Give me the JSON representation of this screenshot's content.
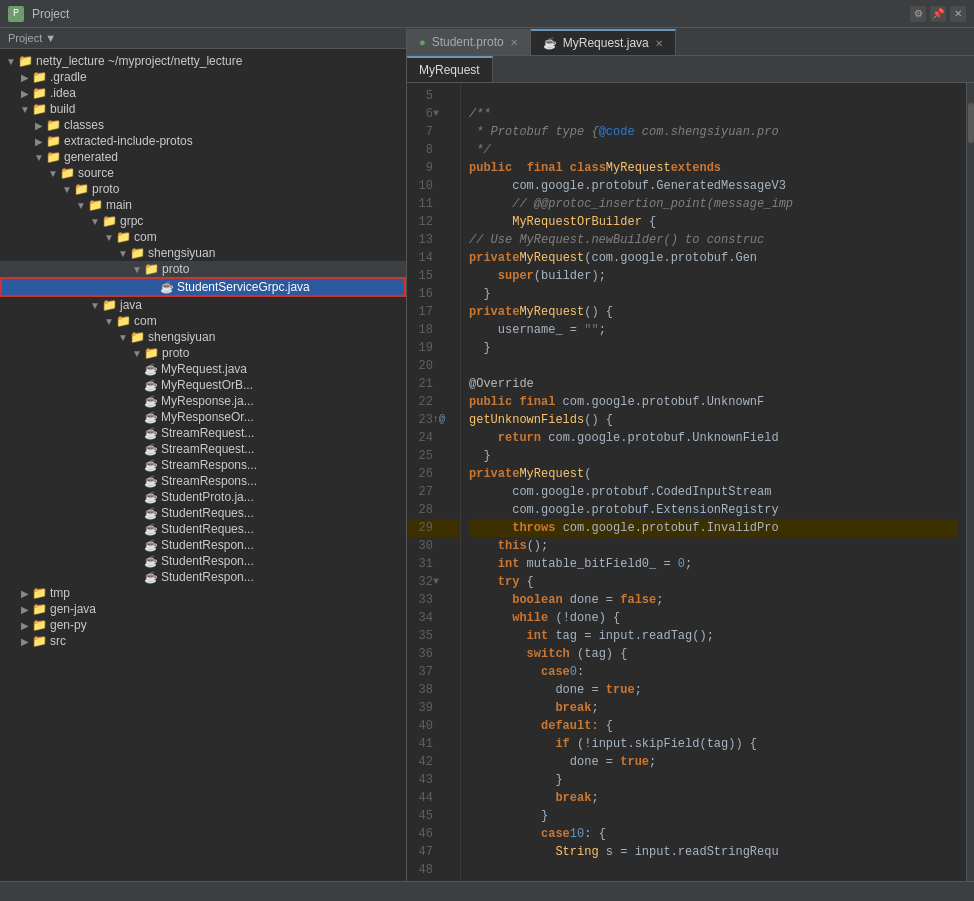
{
  "titleBar": {
    "title": "Project",
    "projectPath": "~/myproject/netty_lecture"
  },
  "tabs": [
    {
      "id": "student-proto",
      "label": "Student.proto",
      "icon": "proto",
      "active": false
    },
    {
      "id": "myrequest-java",
      "label": "MyRequest.java",
      "icon": "java",
      "active": true
    }
  ],
  "editorTabs": [
    {
      "id": "myrequest",
      "label": "MyRequest",
      "active": true
    }
  ],
  "fileTree": {
    "root": "netty_lecture",
    "items": [
      {
        "id": "netty-lecture",
        "label": "netty_lecture ~/myproject/netty_lecture",
        "level": 0,
        "type": "folder",
        "expanded": true
      },
      {
        "id": "gradle",
        "label": ".gradle",
        "level": 1,
        "type": "folder",
        "expanded": false
      },
      {
        "id": "idea",
        "label": ".idea",
        "level": 1,
        "type": "folder",
        "expanded": false
      },
      {
        "id": "build",
        "label": "build",
        "level": 1,
        "type": "folder",
        "expanded": true
      },
      {
        "id": "classes",
        "label": "classes",
        "level": 2,
        "type": "folder",
        "expanded": false
      },
      {
        "id": "extracted-include-protos",
        "label": "extracted-include-protos",
        "level": 2,
        "type": "folder",
        "expanded": false
      },
      {
        "id": "generated",
        "label": "generated",
        "level": 2,
        "type": "folder",
        "expanded": true
      },
      {
        "id": "source",
        "label": "source",
        "level": 3,
        "type": "folder",
        "expanded": true
      },
      {
        "id": "proto",
        "label": "proto",
        "level": 4,
        "type": "folder",
        "expanded": true
      },
      {
        "id": "main",
        "label": "main",
        "level": 5,
        "type": "folder",
        "expanded": true
      },
      {
        "id": "grpc",
        "label": "grpc",
        "level": 6,
        "type": "folder",
        "expanded": true
      },
      {
        "id": "com",
        "label": "com",
        "level": 7,
        "type": "folder",
        "expanded": true
      },
      {
        "id": "shengsiyuan",
        "label": "shengsiyuan",
        "level": 8,
        "type": "folder",
        "expanded": true
      },
      {
        "id": "proto2",
        "label": "proto",
        "level": 9,
        "type": "folder",
        "expanded": true,
        "selected": false
      },
      {
        "id": "student-service-grpc",
        "label": "StudentServiceGrpc.java",
        "level": 10,
        "type": "file-java",
        "selected": true
      },
      {
        "id": "java",
        "label": "java",
        "level": 6,
        "type": "folder",
        "expanded": true
      },
      {
        "id": "com2",
        "label": "com",
        "level": 7,
        "type": "folder",
        "expanded": true
      },
      {
        "id": "shengsiyuan2",
        "label": "shengsiyuan",
        "level": 8,
        "type": "folder",
        "expanded": true
      },
      {
        "id": "proto3",
        "label": "proto",
        "level": 9,
        "type": "folder",
        "expanded": true
      },
      {
        "id": "myrequest-java",
        "label": "MyRequest.java",
        "level": 10,
        "type": "file-java"
      },
      {
        "id": "myrequestorb",
        "label": "MyRequestOrB...",
        "level": 10,
        "type": "file-java"
      },
      {
        "id": "myresponse",
        "label": "MyResponse.ja...",
        "level": 10,
        "type": "file-java"
      },
      {
        "id": "myresponseor",
        "label": "MyResponseOr...",
        "level": 10,
        "type": "file-java"
      },
      {
        "id": "streamrequest1",
        "label": "StreamRequest...",
        "level": 10,
        "type": "file-java"
      },
      {
        "id": "streamrequest2",
        "label": "StreamRequest...",
        "level": 10,
        "type": "file-java"
      },
      {
        "id": "streamrespons1",
        "label": "StreamRespons...",
        "level": 10,
        "type": "file-java"
      },
      {
        "id": "streamrespons2",
        "label": "StreamRespons...",
        "level": 10,
        "type": "file-java"
      },
      {
        "id": "studentproto",
        "label": "StudentProto.ja...",
        "level": 10,
        "type": "file-java"
      },
      {
        "id": "studentreques1",
        "label": "StudentReques...",
        "level": 10,
        "type": "file-java"
      },
      {
        "id": "studentreques2",
        "label": "StudentReques...",
        "level": 10,
        "type": "file-java"
      },
      {
        "id": "studentrespon1",
        "label": "StudentRespon...",
        "level": 10,
        "type": "file-java"
      },
      {
        "id": "studentrespon2",
        "label": "StudentRespon...",
        "level": 10,
        "type": "file-java"
      },
      {
        "id": "studentrespon3",
        "label": "StudentRespon...",
        "level": 10,
        "type": "file-java"
      },
      {
        "id": "tmp",
        "label": "tmp",
        "level": 1,
        "type": "folder",
        "expanded": false
      },
      {
        "id": "gen-java",
        "label": "gen-java",
        "level": 1,
        "type": "folder",
        "expanded": false
      },
      {
        "id": "gen-py",
        "label": "gen-py",
        "level": 1,
        "type": "folder",
        "expanded": false
      },
      {
        "id": "src",
        "label": "src",
        "level": 1,
        "type": "folder",
        "expanded": false
      }
    ]
  },
  "codeLines": [
    {
      "num": 5,
      "content": "",
      "fold": false
    },
    {
      "num": 6,
      "content": "  /**",
      "fold": true
    },
    {
      "num": 7,
      "content": "   * Protobuf type {@code com.shengsiyuan.pro",
      "fold": false
    },
    {
      "num": 8,
      "content": "   */",
      "fold": false
    },
    {
      "num": 9,
      "content": "  public  final class MyRequest extends",
      "fold": false
    },
    {
      "num": 10,
      "content": "      com.google.protobuf.GeneratedMessageV3",
      "fold": false
    },
    {
      "num": 11,
      "content": "      // @@protoc_insertion_point(message_imp",
      "fold": false
    },
    {
      "num": 12,
      "content": "      MyRequestOrBuilder {",
      "fold": false
    },
    {
      "num": 13,
      "content": "  // Use MyRequest.newBuilder() to construc",
      "fold": false
    },
    {
      "num": 14,
      "content": "  private MyRequest(com.google.protobuf.Gen",
      "fold": false
    },
    {
      "num": 15,
      "content": "    super(builder);",
      "fold": false
    },
    {
      "num": 16,
      "content": "  }",
      "fold": false
    },
    {
      "num": 17,
      "content": "  private MyRequest() {",
      "fold": false
    },
    {
      "num": 18,
      "content": "    username_ = \"\";",
      "fold": false
    },
    {
      "num": 19,
      "content": "  }",
      "fold": false
    },
    {
      "num": 20,
      "content": "",
      "fold": false
    },
    {
      "num": 21,
      "content": "  @Override",
      "fold": false
    },
    {
      "num": 22,
      "content": "  public final com.google.protobuf.UnknownF",
      "fold": false
    },
    {
      "num": 23,
      "content": "  getUnknownFields() {",
      "fold": false,
      "gutter": true
    },
    {
      "num": 24,
      "content": "    return com.google.protobuf.UnknownField",
      "fold": false
    },
    {
      "num": 25,
      "content": "  }",
      "fold": false
    },
    {
      "num": 26,
      "content": "  private MyRequest(",
      "fold": false
    },
    {
      "num": 27,
      "content": "      com.google.protobuf.CodedInputStream",
      "fold": false
    },
    {
      "num": 28,
      "content": "      com.google.protobuf.ExtensionRegistry",
      "fold": false
    },
    {
      "num": 29,
      "content": "      throws com.google.protobuf.InvalidPro",
      "fold": false
    },
    {
      "num": 30,
      "content": "    this();",
      "fold": false
    },
    {
      "num": 31,
      "content": "    int mutable_bitField0_ = 0;",
      "fold": false
    },
    {
      "num": 32,
      "content": "    try {",
      "fold": false
    },
    {
      "num": 33,
      "content": "      boolean done = false;",
      "fold": false
    },
    {
      "num": 34,
      "content": "      while (!done) {",
      "fold": false
    },
    {
      "num": 35,
      "content": "        int tag = input.readTag();",
      "fold": false
    },
    {
      "num": 36,
      "content": "        switch (tag) {",
      "fold": false
    },
    {
      "num": 37,
      "content": "          case 0:",
      "fold": false
    },
    {
      "num": 38,
      "content": "            done = true;",
      "fold": false
    },
    {
      "num": 39,
      "content": "            break;",
      "fold": false
    },
    {
      "num": 40,
      "content": "          default: {",
      "fold": false
    },
    {
      "num": 41,
      "content": "            if (!input.skipField(tag)) {",
      "fold": false
    },
    {
      "num": 42,
      "content": "              done = true;",
      "fold": false
    },
    {
      "num": 43,
      "content": "            }",
      "fold": false
    },
    {
      "num": 44,
      "content": "            break;",
      "fold": false
    },
    {
      "num": 45,
      "content": "          }",
      "fold": false
    },
    {
      "num": 46,
      "content": "          case 10: {",
      "fold": false
    },
    {
      "num": 47,
      "content": "            String s = input.readStringRequ",
      "fold": false
    },
    {
      "num": 48,
      "content": "",
      "fold": false
    }
  ],
  "statusBar": {
    "text": ""
  }
}
